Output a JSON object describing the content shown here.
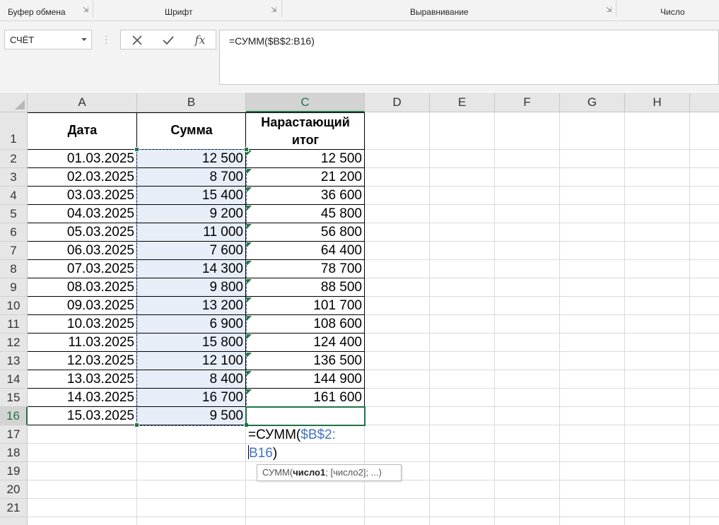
{
  "ribbon": {
    "groups": [
      "Буфер обмена",
      "Шрифт",
      "Выравнивание",
      "Число"
    ]
  },
  "namebox": {
    "value": "СЧЁТ"
  },
  "formula_bar": {
    "cancel_icon": "cancel-x-icon",
    "enter_icon": "checkmark-icon",
    "fx_label": "fx",
    "formula": "=СУММ($B$2:B16)"
  },
  "columns": [
    "A",
    "B",
    "C",
    "D",
    "E",
    "F",
    "G",
    "H"
  ],
  "rows": [
    "1",
    "2",
    "3",
    "4",
    "5",
    "6",
    "7",
    "8",
    "9",
    "10",
    "11",
    "12",
    "13",
    "14",
    "15",
    "16",
    "17",
    "18",
    "19",
    "20",
    "21"
  ],
  "table": {
    "headers": [
      "Дата",
      "Сумма",
      "Нарастающий итог"
    ],
    "header_c_line1": "Нарастающий",
    "header_c_line2": "итог",
    "data": [
      [
        "01.03.2025",
        "12 500",
        "12 500"
      ],
      [
        "02.03.2025",
        "8 700",
        "21 200"
      ],
      [
        "03.03.2025",
        "15 400",
        "36 600"
      ],
      [
        "04.03.2025",
        "9 200",
        "45 800"
      ],
      [
        "05.03.2025",
        "11 000",
        "56 800"
      ],
      [
        "06.03.2025",
        "7 600",
        "64 400"
      ],
      [
        "07.03.2025",
        "14 300",
        "78 700"
      ],
      [
        "08.03.2025",
        "9 800",
        "88 500"
      ],
      [
        "09.03.2025",
        "13 200",
        "101 700"
      ],
      [
        "10.03.2025",
        "6 900",
        "108 600"
      ],
      [
        "11.03.2025",
        "15 800",
        "124 400"
      ],
      [
        "12.03.2025",
        "12 100",
        "136 500"
      ],
      [
        "13.03.2025",
        "8 400",
        "144 900"
      ],
      [
        "14.03.2025",
        "16 700",
        "161 600"
      ],
      [
        "15.03.2025",
        "9 500",
        ""
      ]
    ]
  },
  "editing": {
    "cell": "C16",
    "part1": "=СУММ(",
    "part2_ref": "$B$2:",
    "part3_ref": "B16",
    "part4": ")"
  },
  "tooltip": {
    "func": "СУММ(",
    "arg1": "число1",
    "rest": "; [число2]; ...)"
  },
  "colors": {
    "accent": "#217346",
    "ref": "#4472c4",
    "selection_fill": "#e8eef8"
  }
}
